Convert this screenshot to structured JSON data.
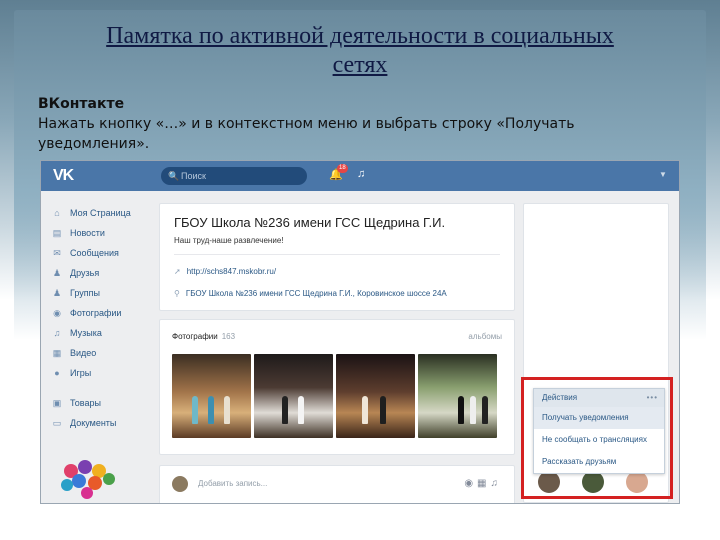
{
  "slide": {
    "title": "Памятка по активной деятельности в социальных сетях",
    "heading": "ВКонтакте",
    "instruction": "Нажать кнопку «…» и в контекстном меню и выбрать строку «Получать уведомления»."
  },
  "vk": {
    "logo": "VK",
    "search_placeholder": "Поиск",
    "notification_count": "18",
    "nav": [
      {
        "label": "Моя Страница",
        "icon": "home-icon"
      },
      {
        "label": "Новости",
        "icon": "news-icon"
      },
      {
        "label": "Сообщения",
        "icon": "messages-icon"
      },
      {
        "label": "Друзья",
        "icon": "friends-icon"
      },
      {
        "label": "Группы",
        "icon": "groups-icon"
      },
      {
        "label": "Фотографии",
        "icon": "photos-icon"
      },
      {
        "label": "Музыка",
        "icon": "music-icon"
      },
      {
        "label": "Видео",
        "icon": "video-icon"
      },
      {
        "label": "Игры",
        "icon": "games-icon"
      },
      {
        "label": "Товары",
        "icon": "market-icon"
      },
      {
        "label": "Документы",
        "icon": "docs-icon"
      }
    ],
    "profile": {
      "name": "ГБОУ Школа №236 имени ГСС Щедрина Г.И.",
      "status": "Наш труд-наше развлечение!",
      "link": "http://schs847.mskobr.ru/",
      "address": "ГБОУ Школа №236 имени ГСС Щедрина Г.И., Коровинское шоссе 24А"
    },
    "photos": {
      "title": "Фотографии",
      "count": "163",
      "albums_label": "альбомы"
    },
    "post": {
      "placeholder": "Добавить запись..."
    },
    "actions_menu": {
      "header": "Действия",
      "dots": "•••",
      "items": [
        "Получать уведомления",
        "Не сообщать о трансляциях",
        "Рассказать друзьям"
      ],
      "selected_index": 0
    },
    "colors": {
      "header": "#4a76a8",
      "link": "#2a5885",
      "highlight": "#d42121"
    }
  }
}
